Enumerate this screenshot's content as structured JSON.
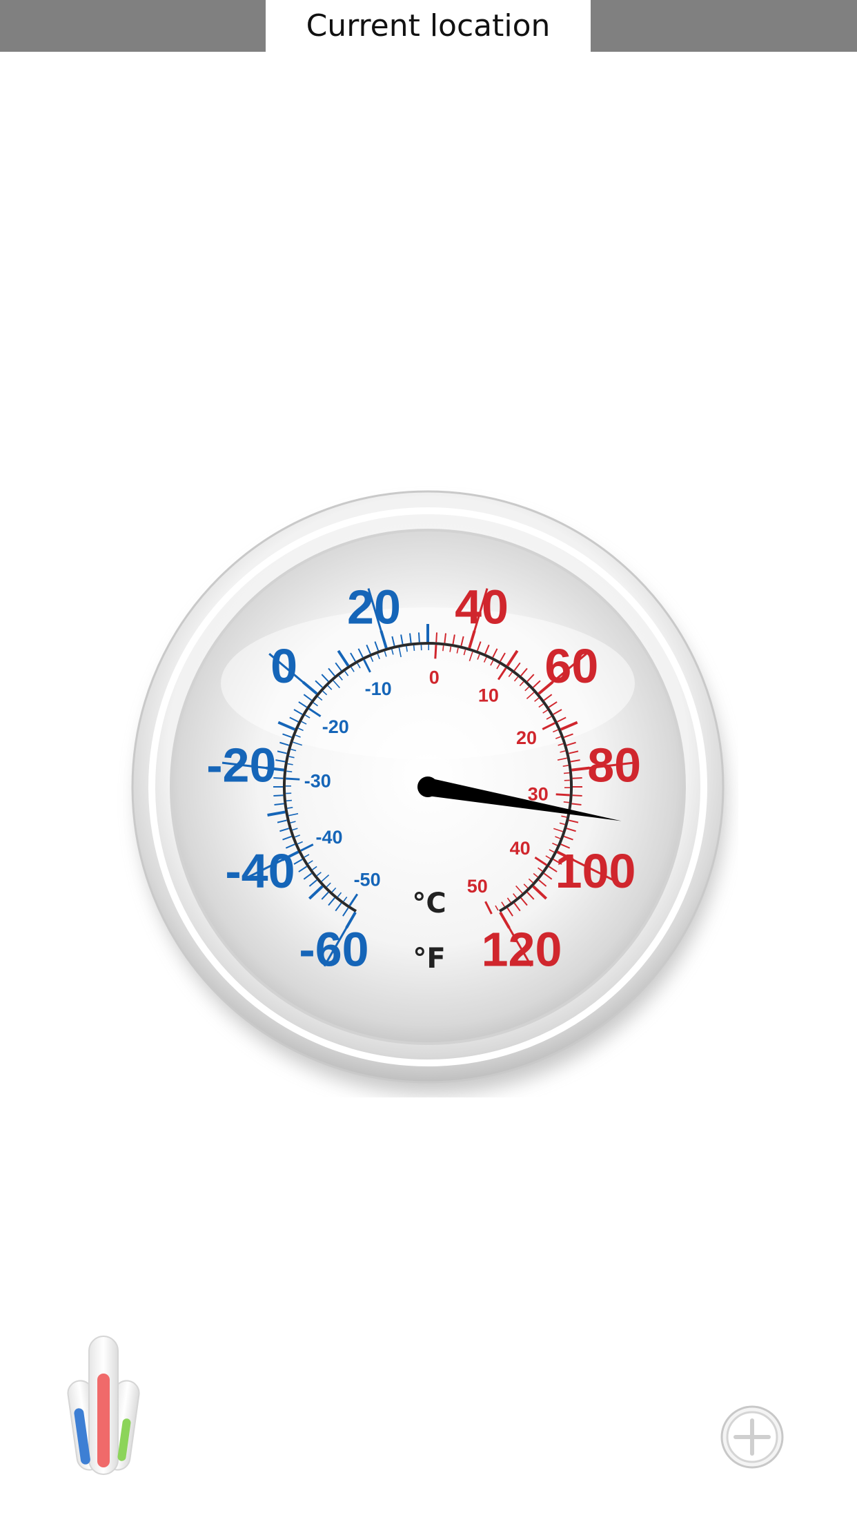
{
  "header": {
    "location_label": "Current location"
  },
  "gauge": {
    "fahrenheit_labels": [
      "-60",
      "-40",
      "-20",
      "0",
      "20",
      "40",
      "60",
      "80",
      "100",
      "120"
    ],
    "celsius_labels": [
      "-50",
      "-40",
      "-30",
      "-20",
      "-10",
      "0",
      "10",
      "20",
      "30",
      "40",
      "50"
    ],
    "celsius_unit": "°C",
    "fahrenheit_unit": "°F",
    "reading_fahrenheit": 90,
    "colors": {
      "cold": "#1565b8",
      "hot": "#d0262d",
      "needle": "#000000"
    }
  },
  "toolbar": {
    "app_icon": "thermometer-bars-icon",
    "add_icon": "plus-circle-icon"
  }
}
